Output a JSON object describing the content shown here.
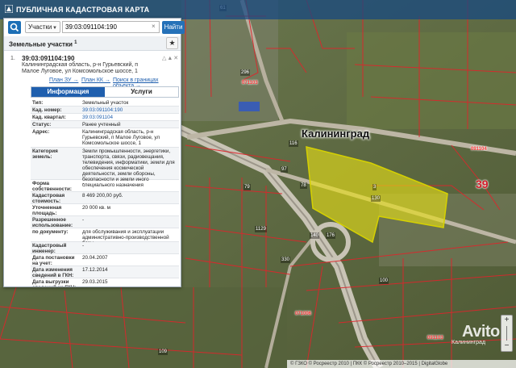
{
  "header": {
    "title": "ПУБЛИЧНАЯ КАДАСТРОВАЯ КАРТА"
  },
  "search": {
    "type_value": "Участки",
    "query": "39:03:091104:190",
    "find_label": "Найти"
  },
  "section": {
    "title": "Земельные участки",
    "count": "1"
  },
  "result": {
    "index": "1.",
    "cadastral_id": "39:03:091104:190",
    "address": "Калининградская область, р-н Гурьевский, п Малое Луговое, ул Комсомольское шоссе, 1",
    "links": [
      "План ЗУ →",
      "План КК →",
      "Поиск в границах объекта →"
    ]
  },
  "tabs": [
    "Информация",
    "Услуги"
  ],
  "info_rows": [
    {
      "k": "Тип:",
      "v": "Земельный участок"
    },
    {
      "k": "Кад. номер:",
      "v": "39:03:091104:190"
    },
    {
      "k": "Кад. квартал:",
      "v": "39:03:091104"
    },
    {
      "k": "Статус:",
      "v": "Ранее учтенный"
    },
    {
      "k": "Адрес:",
      "v": "Калининградская область, р-н Гурьевский, п Малое Луговое, ул Комсомольское шоссе, 1"
    },
    {
      "k": "Категория земель:",
      "v": "Земли промышленности, энергетики, транспорта, связи, радиовещания, телевидения, информатики, земли для обеспечения космической деятельности, земли обороны, безопасности и земли иного специального назначения"
    },
    {
      "k": "Форма собственности:",
      "v": "-"
    },
    {
      "k": "Кадастровая стоимость:",
      "v": "8 469 200,00 руб."
    },
    {
      "k": "Уточненная площадь:",
      "v": "20 000 кв. м"
    },
    {
      "k": "Разрешенное использование:",
      "v": "-"
    },
    {
      "k": "по документу:",
      "v": "для обслуживания и эксплуатации административно-производственной базы"
    },
    {
      "k": "Кадастровый инженер:",
      "v": "-"
    },
    {
      "k": "Дата постановки на учет:",
      "v": "20.04.2007"
    },
    {
      "k": "Дата изменения сведений в ГКН:",
      "v": "17.12.2014"
    },
    {
      "k": "Дата выгрузки сведений из ГКН:",
      "v": "29.03.2015"
    }
  ],
  "map": {
    "city_label": "Калининград",
    "road_number": "39",
    "quarter_labels": [
      "071103",
      "091104",
      "071006",
      "091103"
    ],
    "parcel_labels": [
      "296",
      "61",
      "97",
      "78",
      "116",
      "176",
      "140",
      "1129",
      "330",
      "79",
      "100",
      "3",
      "130",
      "109"
    ]
  },
  "watermark": {
    "brand": "Avito",
    "sub": "Калининград"
  },
  "footer": {
    "text": "© ГЗКО © Росреестр 2010 | ПКК © Росреестр 2010–2015 | DigitalGlobe"
  },
  "colors": {
    "header_bg": "#14468 2",
    "accent": "#1f5fae",
    "parcel_highlight": "#e8e016",
    "boundary": "#e0242b"
  }
}
